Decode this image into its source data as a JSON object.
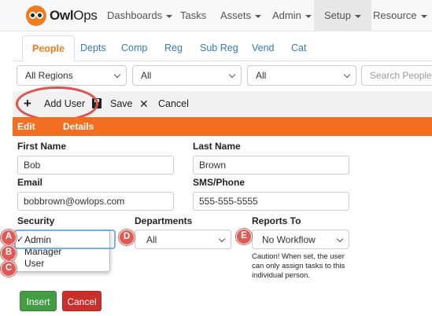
{
  "app": {
    "logo_bold": "Owl",
    "logo_rest": "Ops"
  },
  "nav": {
    "items": [
      {
        "label": "Dashboards",
        "caret": true
      },
      {
        "label": "Tasks",
        "caret": false
      },
      {
        "label": "Assets",
        "caret": true
      },
      {
        "label": "Admin",
        "caret": true
      },
      {
        "label": "Setup",
        "caret": true,
        "active": true
      },
      {
        "label": "Resource",
        "caret": true
      }
    ]
  },
  "tabs": [
    "People",
    "Depts",
    "Comp",
    "Reg",
    "Sub Reg",
    "Vend",
    "Cat"
  ],
  "filters": {
    "region": "All Regions",
    "filter2": "All",
    "filter3": "All",
    "search_placeholder": "Search People"
  },
  "toolbar": {
    "add_label": "Add User",
    "save_label": "Save",
    "cancel_label": "Cancel"
  },
  "section": {
    "edit": "Edit",
    "details": "Details"
  },
  "form": {
    "first_name_label": "First Name",
    "first_name": "Bob",
    "last_name_label": "Last Name",
    "last_name": "Brown",
    "email_label": "Email",
    "email": "bobbrown@owlops.com",
    "phone_label": "SMS/Phone",
    "phone": "555-555-5555",
    "security_label": "Security",
    "security_options": [
      "Admin",
      "Manager",
      "User"
    ],
    "security_selected": "Admin",
    "departments_label": "Departments",
    "departments_value": "All",
    "reports_to_label": "Reports To",
    "reports_to_value": "No Workflow",
    "caution": "Caution! When set, the user can only assign tasks to this individual person."
  },
  "badges": [
    "A",
    "B",
    "C",
    "D",
    "E"
  ],
  "buttons": {
    "insert": "Insert",
    "cancel": "Cancel"
  },
  "colors": {
    "brand_orange": "#f26f21",
    "link_blue": "#337ab7",
    "annotation_red": "#e05a55",
    "insert_green": "#449d44",
    "cancel_red": "#c9302c"
  }
}
